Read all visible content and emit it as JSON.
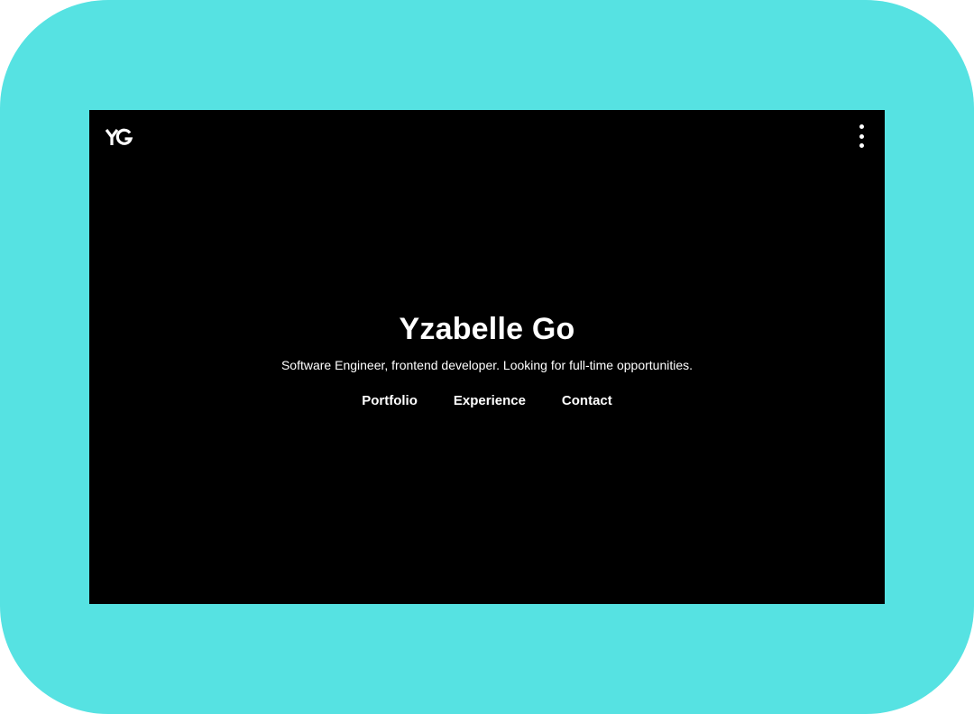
{
  "colors": {
    "frame": "#56e2e2",
    "screen": "#000000",
    "text": "#ffffff"
  },
  "header": {
    "logo": "YG",
    "logo_icon": "yg-monogram-icon",
    "menu_icon": "kebab-menu-icon"
  },
  "hero": {
    "title": "Yzabelle Go",
    "tagline": "Software Engineer, frontend developer. Looking for full-time opportunities.",
    "nav": [
      {
        "label": "Portfolio"
      },
      {
        "label": "Experience"
      },
      {
        "label": "Contact"
      }
    ]
  }
}
